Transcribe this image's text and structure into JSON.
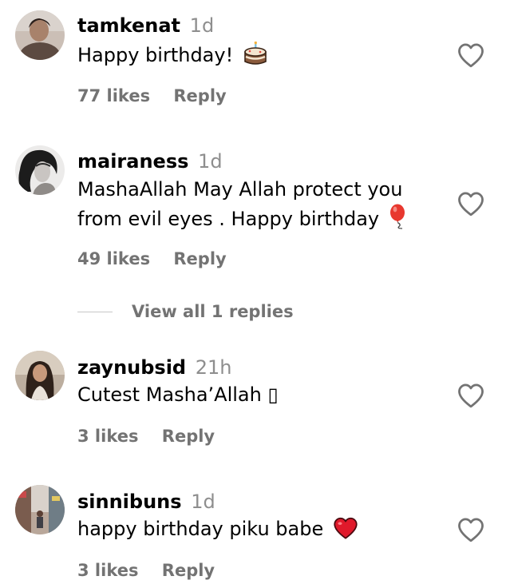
{
  "comments": [
    {
      "username": "tamkenat",
      "time": "1d",
      "text": "Happy birthday! ",
      "emoji": "birthday-cake",
      "likes": "77 likes",
      "reply": "Reply"
    },
    {
      "username": "mairaness",
      "time": "1d",
      "text_line1": "MashaAllah May Allah protect you",
      "text_line2": "from evil eyes . Happy birthday ",
      "emoji": "balloon",
      "likes": "49 likes",
      "reply": "Reply"
    },
    {
      "username": "zaynubsid",
      "time": "21h",
      "text": "Cutest Masha’Allah ▯",
      "likes": "3 likes",
      "reply": "Reply"
    },
    {
      "username": "sinnibuns",
      "time": "1d",
      "text": "happy birthday piku babe ",
      "emoji": "red-heart",
      "likes": "3 likes",
      "reply": "Reply"
    }
  ],
  "view_replies": "View all 1 replies",
  "colors": {
    "text": "#000000",
    "secondary": "#737373",
    "timestamp": "#8e8e8e",
    "divider": "#c7c7c7",
    "heart_outline": "#737373",
    "emoji_heart": "#e0192b"
  }
}
